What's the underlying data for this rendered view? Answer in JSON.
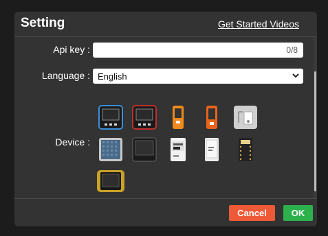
{
  "dialog": {
    "title": "Setting",
    "help_link": "Get Started Videos"
  },
  "fields": {
    "api_key": {
      "label": "Api key :",
      "value": "",
      "counter": "0/8"
    },
    "language": {
      "label": "Language :",
      "selected": "English"
    },
    "device": {
      "label": "Device :"
    }
  },
  "devices": [
    {
      "name": "core-dark-device",
      "selected": true
    },
    {
      "name": "core-red-device",
      "selected": false
    },
    {
      "name": "stickc-orange-device",
      "selected": false
    },
    {
      "name": "stickc-plus-orange-device",
      "selected": false
    },
    {
      "name": "module-grey-device",
      "selected": false
    },
    {
      "name": "atom-matrix-device",
      "selected": false
    },
    {
      "name": "core2-device",
      "selected": false
    },
    {
      "name": "coreink-device",
      "selected": false
    },
    {
      "name": "paper-device",
      "selected": false
    },
    {
      "name": "atom-lite-device",
      "selected": false
    },
    {
      "name": "tough-device",
      "selected": false
    }
  ],
  "footer": {
    "cancel_label": "Cancel",
    "ok_label": "OK"
  },
  "colors": {
    "cancel": "#ee5a37",
    "ok": "#2cb14c",
    "selected_outline": "#3a8fd8",
    "dialog_bg": "#333333"
  }
}
